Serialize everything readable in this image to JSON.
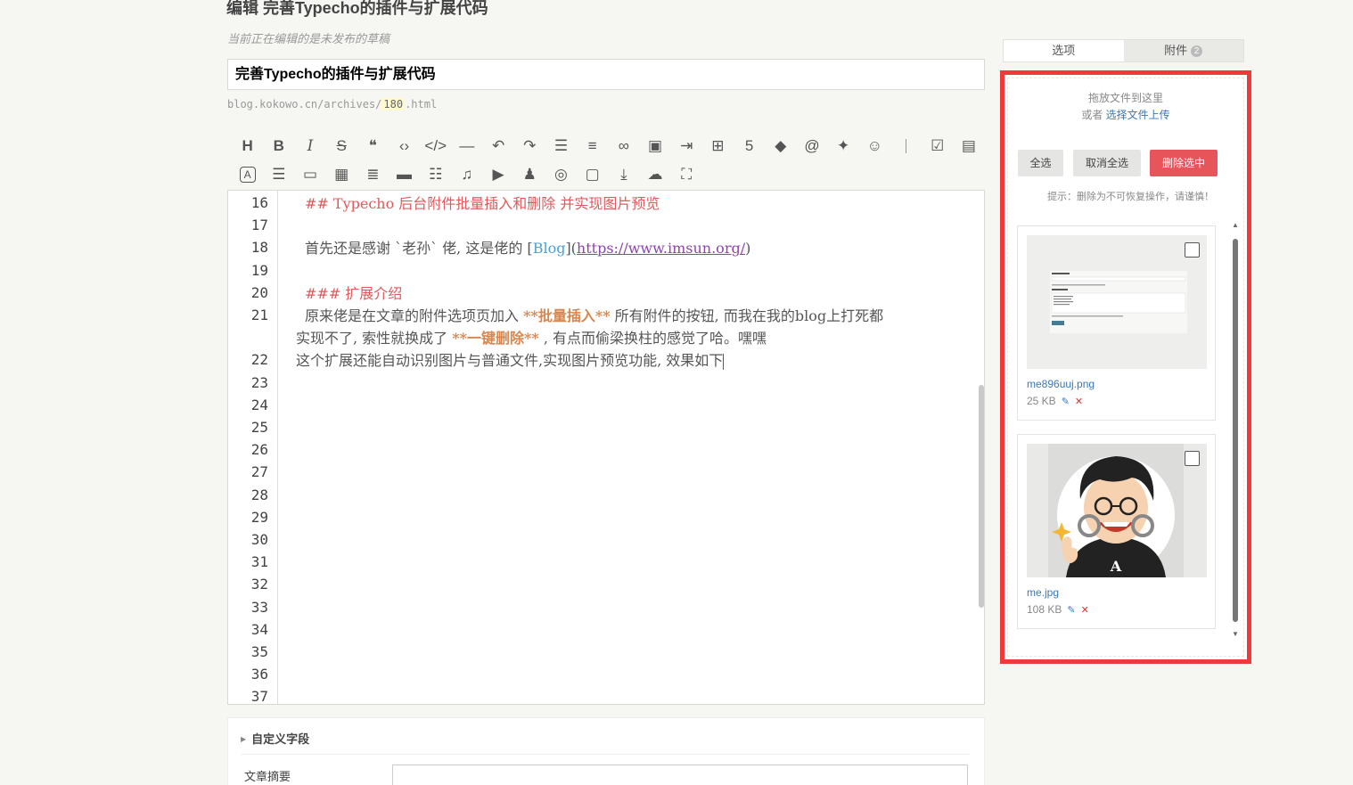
{
  "header": {
    "title": "编辑 完善Typecho的插件与扩展代码",
    "draft_note": "当前正在编辑的是未发布的草稿"
  },
  "post": {
    "title_value": "完善Typecho的插件与扩展代码",
    "permalink_prefix": "blog.kokowo.cn/archives/",
    "permalink_slug": "180",
    "permalink_suffix": ".html"
  },
  "toolbar": {
    "row1": [
      "heading-icon",
      "bold-icon",
      "italic-icon",
      "strikethrough-icon",
      "quote-icon",
      "inline-code-icon",
      "code-block-icon",
      "horizontal-rule-icon",
      "undo-icon",
      "redo-icon",
      "ordered-list-icon",
      "unordered-list-icon",
      "link-icon",
      "image-icon",
      "indent-icon",
      "table-icon",
      "html5-icon",
      "eraser-icon",
      "at-icon",
      "emoji-gallery-icon",
      "smile-icon",
      "separator",
      "checklist-icon",
      "picture-gallery-icon"
    ],
    "row2": [
      "text-a-icon",
      "server-icon",
      "storage-icon",
      "calendar-icon",
      "align-left-icon",
      "card-icon",
      "list-box-icon",
      "music-icon",
      "play-icon",
      "users-icon",
      "hidden-icon",
      "bilibili-icon",
      "download-icon",
      "cloud-icon",
      "fullscreen-icon"
    ]
  },
  "editor": {
    "lines": [
      {
        "n": "16",
        "parts": [
          {
            "t": "## Typecho 后台附件批量插入和删除 并实现图片预览",
            "c": "hd"
          }
        ]
      },
      {
        "n": "17",
        "parts": []
      },
      {
        "n": "18",
        "parts": [
          {
            "t": "首先还是感谢 `老孙` 佬, 这是佬的 [",
            "c": ""
          },
          {
            "t": "Blog",
            "c": "md-link"
          },
          {
            "t": "](",
            "c": ""
          },
          {
            "t": "https://www.imsun.org/",
            "c": "url"
          },
          {
            "t": ")",
            "c": ""
          }
        ]
      },
      {
        "n": "19",
        "parts": []
      },
      {
        "n": "20",
        "parts": [
          {
            "t": "### 扩展介绍",
            "c": "hd"
          }
        ]
      },
      {
        "n": "21",
        "parts": [
          {
            "t": "原来佬是在文章的附件选项页加入 ",
            "c": ""
          },
          {
            "t": "**批量插入**",
            "c": "strong"
          },
          {
            "t": " 所有附件的按钮, 而我在我的blog上打死都",
            "c": ""
          }
        ]
      },
      {
        "n": "",
        "parts": [
          {
            "t": "实现不了, 索性就换成了 ",
            "c": ""
          },
          {
            "t": "**一键删除**",
            "c": "strong"
          },
          {
            "t": " , 有点而偷梁换柱的感觉了哈。嘿嘿",
            "c": ""
          }
        ]
      },
      {
        "n": "22",
        "parts": [
          {
            "t": "这个扩展还能自动识别图片与普通文件,实现图片预览功能, 效果如下",
            "c": ""
          }
        ]
      },
      {
        "n": "23",
        "parts": []
      },
      {
        "n": "24",
        "parts": []
      },
      {
        "n": "25",
        "parts": []
      },
      {
        "n": "26",
        "parts": []
      },
      {
        "n": "27",
        "parts": []
      },
      {
        "n": "28",
        "parts": []
      },
      {
        "n": "29",
        "parts": []
      },
      {
        "n": "30",
        "parts": []
      },
      {
        "n": "31",
        "parts": []
      },
      {
        "n": "32",
        "parts": []
      },
      {
        "n": "33",
        "parts": []
      },
      {
        "n": "34",
        "parts": []
      },
      {
        "n": "35",
        "parts": []
      },
      {
        "n": "36",
        "parts": []
      },
      {
        "n": "37",
        "parts": []
      }
    ]
  },
  "custom_fields": {
    "title": "自定义字段",
    "summary_label": "文章摘要",
    "summary_value": ""
  },
  "sidebar": {
    "tab_options": "选项",
    "tab_attachments": "附件",
    "attachments_count": "2",
    "drop_hint": "拖放文件到这里",
    "or_text": "或者 ",
    "upload_link": "选择文件上传",
    "select_all": "全选",
    "deselect_all": "取消全选",
    "delete_selected": "删除选中",
    "warning": "提示：删除为不可恢复操作，请谨慎！",
    "files": [
      {
        "name": "me896uuj.png",
        "size": "25 KB",
        "type": "screenshot"
      },
      {
        "name": "me.jpg",
        "size": "108 KB",
        "type": "avatar"
      }
    ]
  },
  "colors": {
    "accent_red": "#ee3a3a",
    "delete_button": "#e7555a",
    "link_blue": "#3a78b8",
    "heading_red": "#e0595c",
    "bold_orange": "#d7874f",
    "url_purple": "#8e44ad"
  }
}
